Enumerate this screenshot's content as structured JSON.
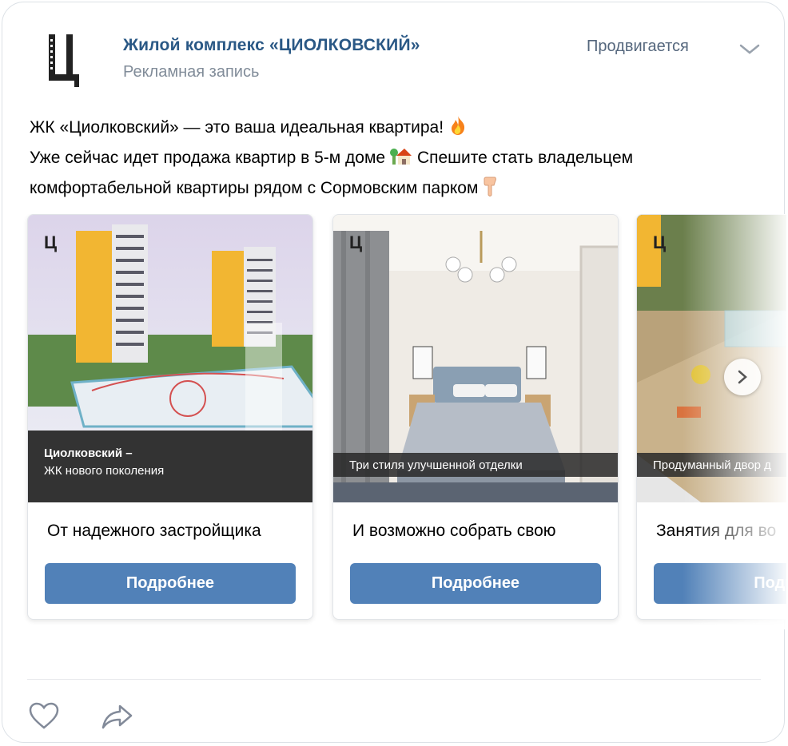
{
  "post": {
    "author": "Жилой комплекс «ЦИОЛКОВСКИЙ»",
    "subtitle": "Рекламная запись",
    "status": "Продвигается",
    "text_line1": "ЖК «Циолковский» — это ваша идеальная квартира!",
    "text_line2": "Уже сейчас идет продажа квартир в 5-м доме",
    "text_line2b": "Спешите стать владельцем",
    "text_line3": "комфортабельной квартиры рядом с Сормовским парком"
  },
  "icons": {
    "logo": "tsiolkovsky-logo-icon",
    "menu": "chevron-down-icon",
    "fire": "fire-emoji-icon",
    "house": "house-emoji-icon",
    "point": "point-down-emoji-icon",
    "next": "chevron-right-icon",
    "like": "heart-icon",
    "share": "share-arrow-icon"
  },
  "colors": {
    "link": "#2a5885",
    "muted": "#818c99",
    "button": "#5181b8"
  },
  "carousel": {
    "slides": [
      {
        "caption": "От надежного застройщика",
        "button": "Подробнее",
        "banner_title": "Циолковский –",
        "banner_sub": "ЖК нового поколения",
        "corner_mark": "Ц"
      },
      {
        "caption": "И возможно собрать свою",
        "button": "Подробнее",
        "strip_text": "Три стиля  улучшенной отделки",
        "corner_mark": "Ц"
      },
      {
        "caption": "Занятия для во",
        "button": "Подро",
        "strip_text": "Продуманный двор д",
        "corner_mark": "Ц"
      }
    ]
  }
}
